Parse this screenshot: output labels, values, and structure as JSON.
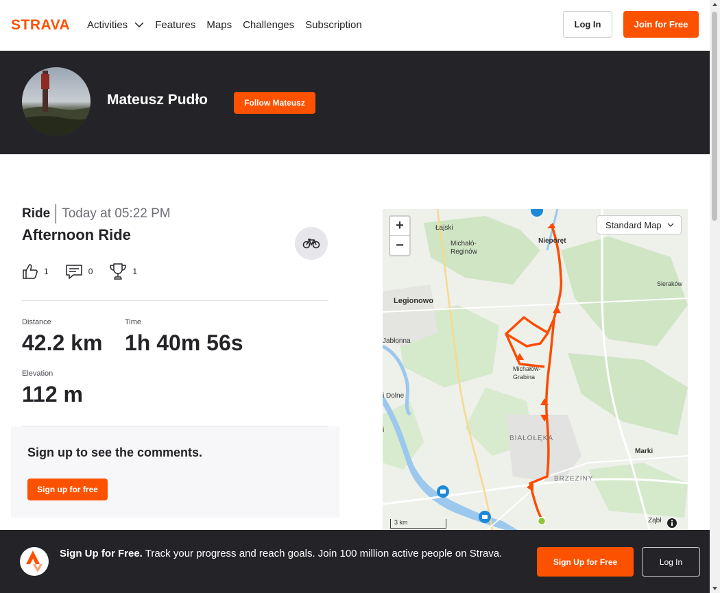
{
  "nav": {
    "logo_text": "STRAVA",
    "links": [
      "Activities",
      "Features",
      "Maps",
      "Challenges",
      "Subscription"
    ],
    "login_label": "Log In",
    "join_label": "Join for Free"
  },
  "athlete": {
    "name": "Mateusz Pudło",
    "follow_label": "Follow Mateusz"
  },
  "activity": {
    "type": "Ride",
    "date": "Today at 05:22 PM",
    "title": "Afternoon Ride",
    "kudos": "1",
    "comments": "0",
    "achievements": "1",
    "stats": {
      "distance_label": "Distance",
      "distance_value": "42.2 km",
      "time_label": "Time",
      "time_value": "1h 40m 56s",
      "elevation_label": "Elevation",
      "elevation_value": "112 m"
    }
  },
  "comments_box": {
    "title": "Sign up to see the comments.",
    "button_label": "Sign up for free"
  },
  "map": {
    "zoom_in": "+",
    "zoom_out": "−",
    "style_select": "Standard Map",
    "scale_label": "3 km",
    "places": {
      "lajski": "Łajski",
      "michalo_reginow": "Michałó-\nReginów",
      "nieporet": "Nieporęt",
      "sierakow": "Sieraków",
      "legionowo": "Legionowo",
      "jablonna": "Jabłonna",
      "michalow_grabina": "Michałów-\nGrabina",
      "dolne": "i Dolne",
      "bialoleka": "BIAŁOŁĘKA",
      "marki": "Marki",
      "brzeziny": "BRZEZINY",
      "zabki": "Ząbł",
      "i": "i"
    }
  },
  "signup_banner": {
    "bold": "Sign Up for Free.",
    "text": " Track your progress and reach goals. Join 100 million active people on Strava.",
    "signup_label": "Sign Up for Free",
    "login_label": "Log In"
  },
  "colors": {
    "brand": "#fc5200",
    "dark": "#242428",
    "route": "#fc4c02"
  }
}
